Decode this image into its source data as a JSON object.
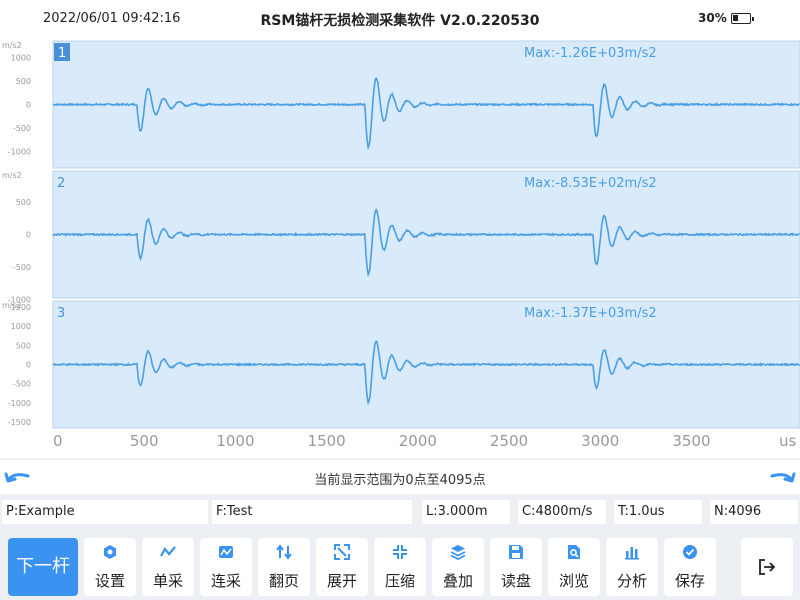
{
  "status": {
    "datetime": "2022/06/01 09:42:16",
    "app_title": "RSM锚杆无损检测采集软件 V2.0.220530",
    "battery_percent": "30%"
  },
  "chart_data": [
    {
      "type": "line",
      "channel": "1",
      "max_label": "Max:-1.26E+03m/s2",
      "ylabel": "m/s2",
      "yticks": [
        "1000",
        "500",
        "0",
        "-500",
        "-1000"
      ],
      "ylim": [
        -1350,
        1350
      ],
      "xlim": [
        0,
        4095
      ],
      "line_color": "#4a9ee3",
      "bg_color": "#d9eafb",
      "events": [
        {
          "x": 500,
          "amplitude": 780
        },
        {
          "x": 1750,
          "amplitude": 1260
        },
        {
          "x": 3000,
          "amplitude": 950
        }
      ]
    },
    {
      "type": "line",
      "channel": "2",
      "max_label": "Max:-8.53E+02m/s2",
      "ylabel": "m/s2",
      "yticks": [
        "500",
        "0",
        "-500",
        "-1000"
      ],
      "ylim": [
        -980,
        980
      ],
      "xlim": [
        0,
        4095
      ],
      "line_color": "#4a9ee3",
      "bg_color": "#d9eafb",
      "events": [
        {
          "x": 500,
          "amplitude": 510
        },
        {
          "x": 1750,
          "amplitude": 853
        },
        {
          "x": 3000,
          "amplitude": 650
        }
      ]
    },
    {
      "type": "line",
      "channel": "3",
      "max_label": "Max:-1.37E+03m/s2",
      "ylabel": "m/s2",
      "yticks": [
        "1500",
        "1000",
        "500",
        "0",
        "-500",
        "-1000",
        "-1500"
      ],
      "ylim": [
        -1650,
        1650
      ],
      "xlim": [
        0,
        4095
      ],
      "line_color": "#4a9ee3",
      "bg_color": "#d9eafb",
      "events": [
        {
          "x": 500,
          "amplitude": 760
        },
        {
          "x": 1750,
          "amplitude": 1370
        },
        {
          "x": 3000,
          "amplitude": 860
        }
      ]
    }
  ],
  "x_axis": {
    "ticks": [
      0,
      500,
      1000,
      1500,
      2000,
      2500,
      3000,
      3500
    ],
    "unit": "us"
  },
  "range_text": "当前显示范围为0点至4095点",
  "params": {
    "p": "P:Example",
    "f": "F:Test",
    "l": "L:3.000m",
    "c": "C:4800m/s",
    "t": "T:1.0us",
    "n": "N:4096"
  },
  "toolbar": {
    "next": "下一杆",
    "buttons": [
      {
        "label": "设置",
        "icon": "settings-icon"
      },
      {
        "label": "单采",
        "icon": "single-acquire-icon"
      },
      {
        "label": "连采",
        "icon": "continuous-acquire-icon"
      },
      {
        "label": "翻页",
        "icon": "page-flip-icon"
      },
      {
        "label": "展开",
        "icon": "expand-icon"
      },
      {
        "label": "压缩",
        "icon": "compress-icon"
      },
      {
        "label": "叠加",
        "icon": "stack-icon"
      },
      {
        "label": "读盘",
        "icon": "disk-read-icon"
      },
      {
        "label": "浏览",
        "icon": "browse-icon"
      },
      {
        "label": "分析",
        "icon": "analysis-icon"
      },
      {
        "label": "保存",
        "icon": "save-icon"
      }
    ],
    "accent_color": "#3a93f0"
  }
}
